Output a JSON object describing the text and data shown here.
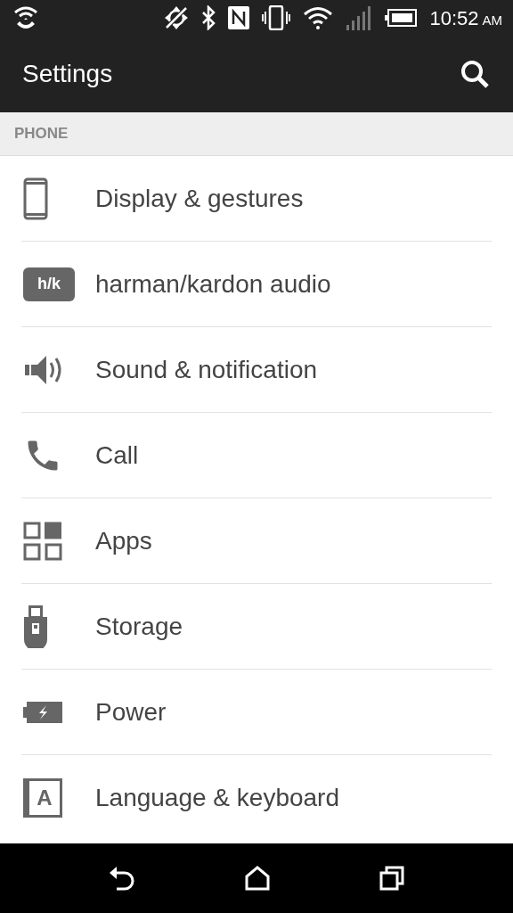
{
  "status_bar": {
    "time": "10:52",
    "ampm": "AM"
  },
  "app_bar": {
    "title": "Settings"
  },
  "section": {
    "header": "PHONE"
  },
  "items": [
    {
      "kind": "display",
      "label": "Display & gestures"
    },
    {
      "kind": "logo",
      "label": "harman/kardon audio",
      "logo_text": "h/k"
    },
    {
      "kind": "sound",
      "label": "Sound & notification"
    },
    {
      "kind": "call",
      "label": "Call"
    },
    {
      "kind": "apps",
      "label": "Apps"
    },
    {
      "kind": "storage",
      "label": "Storage"
    },
    {
      "kind": "power",
      "label": "Power"
    },
    {
      "kind": "language",
      "label": "Language & keyboard",
      "icon_letter": "A"
    }
  ]
}
